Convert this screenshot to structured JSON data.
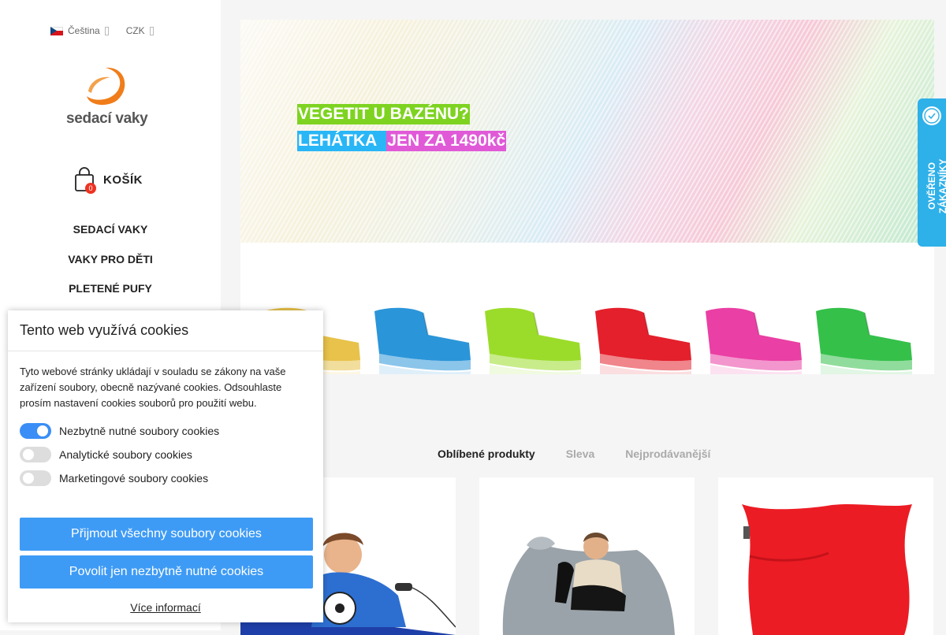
{
  "topbar": {
    "language": "Čeština",
    "currency": "CZK"
  },
  "logo": {
    "text": "sedací vaky"
  },
  "cart": {
    "count": "0",
    "label": "KOŠÍK"
  },
  "nav": {
    "items": [
      "SEDACÍ VAKY",
      "VAKY PRO DĚTI",
      "PLETENÉ PUFY"
    ]
  },
  "banner": {
    "line1": "VEGETIT U BAZÉNU?",
    "line2a": "LEHÁTKA ",
    "line2b": "JEN ZA 1490kč"
  },
  "loungers": {
    "colors": [
      "#e8c24a",
      "#2b95d9",
      "#9bdc2a",
      "#e3202c",
      "#ea3fa4",
      "#35c04a"
    ]
  },
  "cookie": {
    "title": "Tento web využívá cookies",
    "description": "Tyto webové stránky ukládají v souladu se zákony na vaše zařízení soubory, obecně nazývané cookies. Odsouhlaste prosím nastavení cookies souborů pro použití webu.",
    "toggles": [
      {
        "label": "Nezbytně nutné soubory cookies",
        "on": true
      },
      {
        "label": "Analytické soubory cookies",
        "on": false
      },
      {
        "label": "Marketingové soubory cookies",
        "on": false
      }
    ],
    "accept_all": "Přijmout všechny soubory cookies",
    "accept_necessary": "Povolit jen nezbytně nutné cookies",
    "more": "Více informací"
  },
  "tabs": [
    "Oblíbené produkty",
    "Sleva",
    "Nejprodávanější"
  ],
  "verify": {
    "label": "OVĚŘENO ZÁKAZNÍKY"
  },
  "colors": {
    "accent": "#3e9bf5",
    "verify": "#2eb0e8",
    "brand_orange": "#f07d1a",
    "badge": "#e32"
  }
}
